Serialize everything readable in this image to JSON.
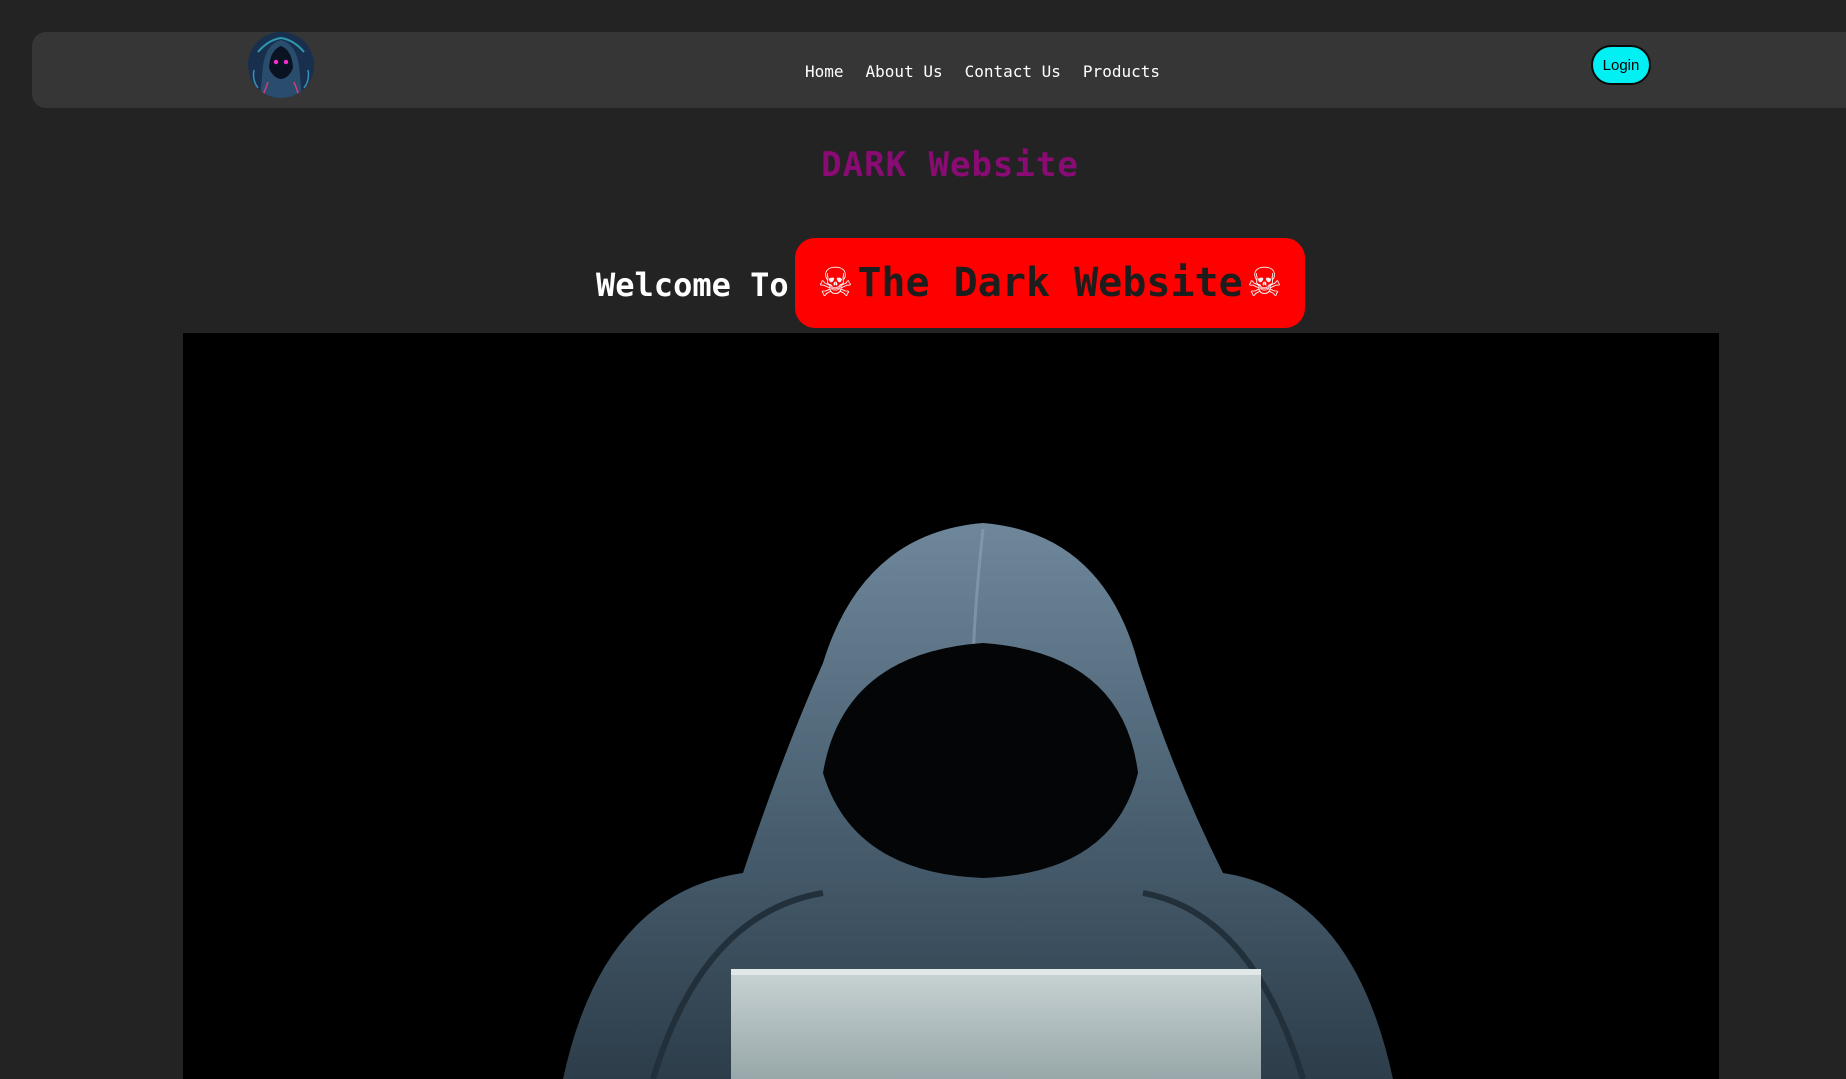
{
  "nav": {
    "logo": "hooded-hacker-logo",
    "links": [
      "Home",
      "About Us",
      "Contact Us",
      "Products"
    ],
    "login_label": "Login"
  },
  "page": {
    "title": "DARK Website",
    "welcome_label": "Welcome To",
    "brand": {
      "icon_left": "skull-crossbones-icon",
      "text": "The Dark Website",
      "icon_right": "skull-crossbones-icon",
      "badge_color": "#ff0000"
    },
    "hero_image": "hooded-figure-laptop"
  },
  "colors": {
    "background": "#232323",
    "navbar": "#373636",
    "title": "#8a0b73",
    "login": "#00f0f4"
  }
}
